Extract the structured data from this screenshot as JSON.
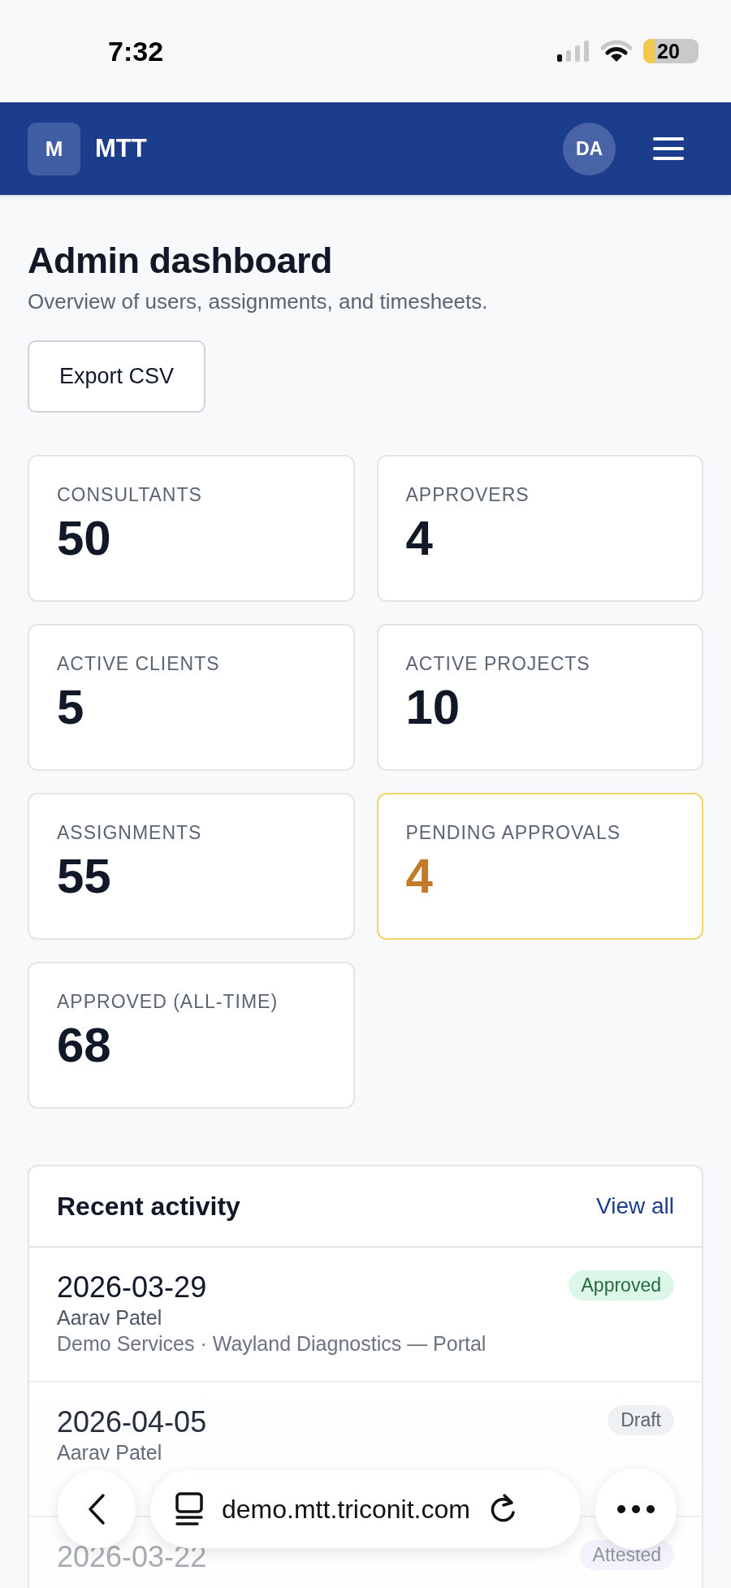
{
  "status_bar": {
    "time": "7:32",
    "battery": "20"
  },
  "header": {
    "logo": "M",
    "brand": "MTT",
    "avatar": "DA"
  },
  "page": {
    "title": "Admin dashboard",
    "subtitle": "Overview of users, assignments, and timesheets.",
    "export_button": "Export CSV"
  },
  "stats": [
    {
      "label": "CONSULTANTS",
      "value": "50",
      "highlighted": false
    },
    {
      "label": "APPROVERS",
      "value": "4",
      "highlighted": false
    },
    {
      "label": "ACTIVE CLIENTS",
      "value": "5",
      "highlighted": false
    },
    {
      "label": "ACTIVE PROJECTS",
      "value": "10",
      "highlighted": false
    },
    {
      "label": "ASSIGNMENTS",
      "value": "55",
      "highlighted": false
    },
    {
      "label": "PENDING APPROVALS",
      "value": "4",
      "highlighted": true
    },
    {
      "label": "APPROVED (ALL-TIME)",
      "value": "68",
      "highlighted": false
    }
  ],
  "recent_activity": {
    "title": "Recent activity",
    "link": "View all",
    "items": [
      {
        "date": "2026-03-29",
        "name": "Aarav Patel",
        "detail": "Demo Services · Wayland Diagnostics — Portal",
        "status": "Approved",
        "kind": "approved"
      },
      {
        "date": "2026-04-05",
        "name": "Aarav Patel",
        "status": "Draft",
        "kind": "draft"
      },
      {
        "date": "2026-03-22",
        "status": "Attested",
        "kind": "attested"
      }
    ]
  },
  "browser_bar": {
    "url": "demo.mtt.triconit.com"
  }
}
